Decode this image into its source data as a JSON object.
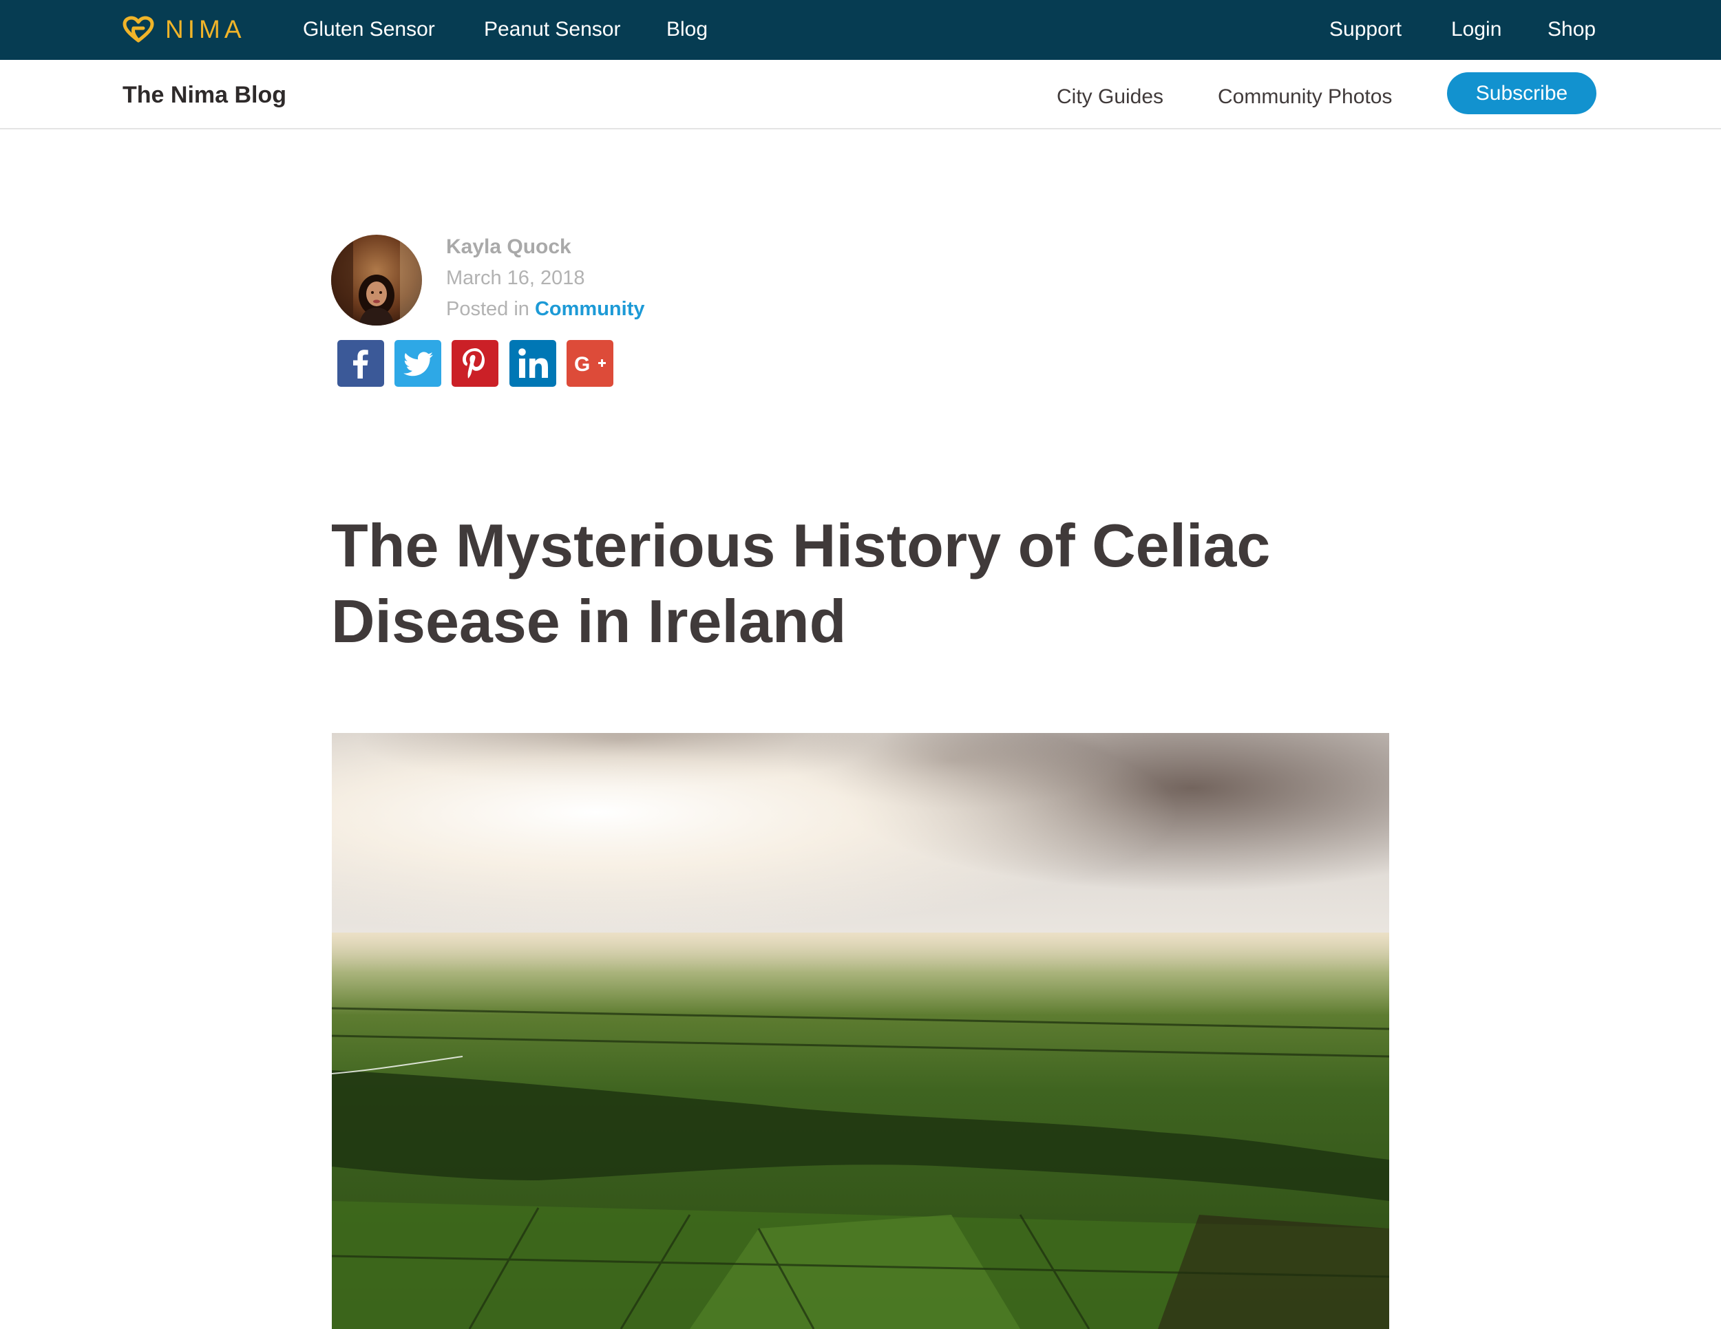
{
  "nav": {
    "brand": "NIMA",
    "links": [
      "Gluten Sensor",
      "Peanut Sensor",
      "Blog"
    ],
    "right_links": [
      "Support",
      "Login",
      "Shop"
    ]
  },
  "blog_nav": {
    "title": "The Nima Blog",
    "links": [
      "City Guides",
      "Community Photos"
    ],
    "subscribe_label": "Subscribe"
  },
  "post": {
    "author": "Kayla Quock",
    "date": "March 16, 2018",
    "posted_in_prefix": "Posted in ",
    "category": "Community",
    "title": "The Mysterious History of Celiac Disease in Ireland"
  },
  "share": [
    {
      "network": "facebook",
      "icon": "facebook-icon",
      "color": "#3b5998"
    },
    {
      "network": "twitter",
      "icon": "twitter-icon",
      "color": "#2ea8e6"
    },
    {
      "network": "pinterest",
      "icon": "pinterest-icon",
      "color": "#cb2027"
    },
    {
      "network": "linkedin",
      "icon": "linkedin-icon",
      "color": "#0077b5"
    },
    {
      "network": "google-plus",
      "icon": "google-plus-icon",
      "color": "#dd4b39"
    }
  ],
  "colors": {
    "nav_bg": "#063c52",
    "brand_gold": "#f0b429",
    "accent_blue": "#1292cf",
    "heading": "#403a3a"
  }
}
